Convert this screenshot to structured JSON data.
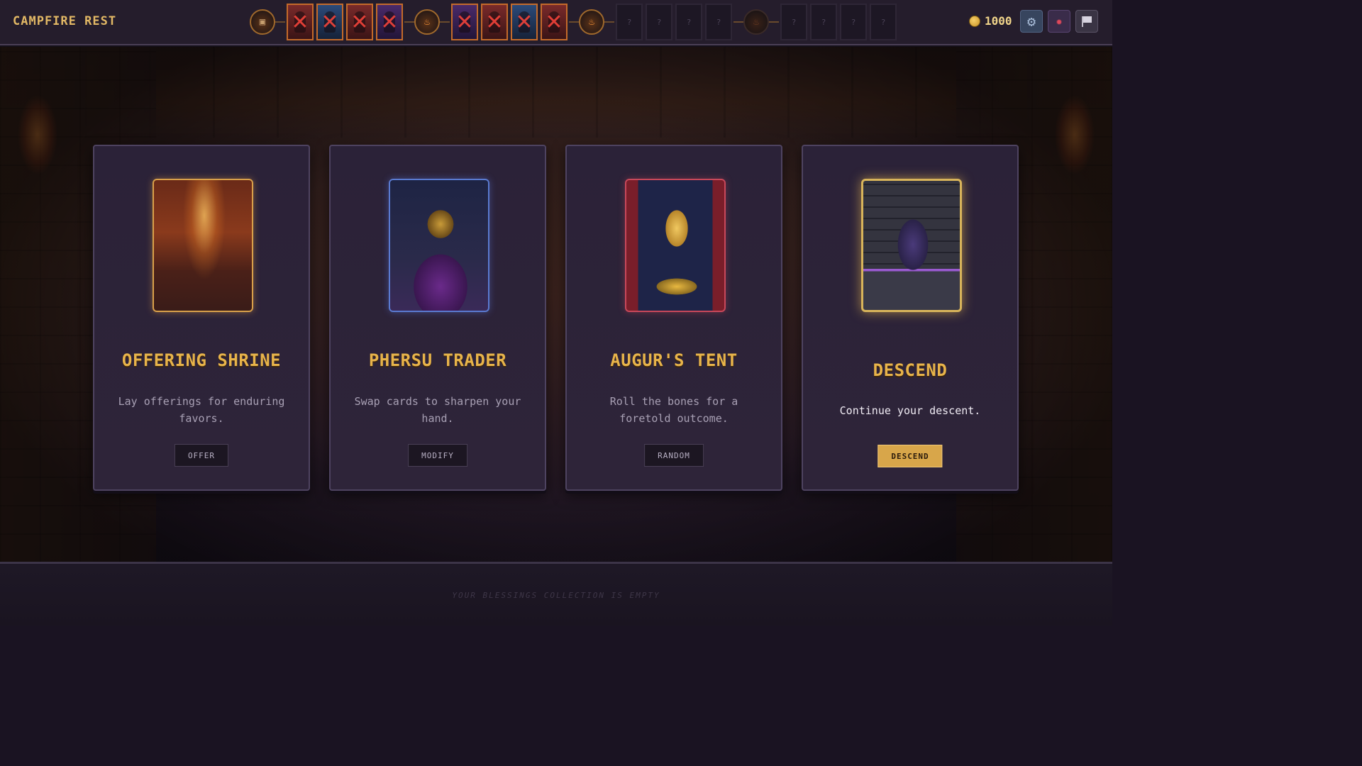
{
  "header": {
    "location_title": "CAMPFIRE REST",
    "gold": "1000"
  },
  "path": {
    "segments": [
      {
        "type": "node",
        "state": "start",
        "icon": "door-icon"
      },
      {
        "type": "encounter",
        "state": "defeated",
        "theme": "red"
      },
      {
        "type": "encounter",
        "state": "defeated",
        "theme": "blue"
      },
      {
        "type": "encounter",
        "state": "defeated",
        "theme": "red"
      },
      {
        "type": "encounter",
        "state": "defeated",
        "theme": "purple"
      },
      {
        "type": "node",
        "state": "campfire",
        "icon": "campfire-icon"
      },
      {
        "type": "encounter",
        "state": "defeated",
        "theme": "purple"
      },
      {
        "type": "encounter",
        "state": "defeated",
        "theme": "red"
      },
      {
        "type": "encounter",
        "state": "defeated",
        "theme": "blue"
      },
      {
        "type": "encounter",
        "state": "defeated",
        "theme": "red"
      },
      {
        "type": "node",
        "state": "current-campfire",
        "icon": "campfire-icon"
      },
      {
        "type": "encounter",
        "state": "unknown",
        "label": "?"
      },
      {
        "type": "encounter",
        "state": "unknown",
        "label": "?"
      },
      {
        "type": "encounter",
        "state": "unknown",
        "label": "?"
      },
      {
        "type": "encounter",
        "state": "unknown",
        "label": "?"
      },
      {
        "type": "node",
        "state": "locked-campfire",
        "icon": "campfire-icon"
      },
      {
        "type": "encounter",
        "state": "unknown",
        "label": "?"
      },
      {
        "type": "encounter",
        "state": "unknown",
        "label": "?"
      },
      {
        "type": "encounter",
        "state": "unknown",
        "label": "?"
      },
      {
        "type": "encounter",
        "state": "unknown",
        "label": "?"
      }
    ]
  },
  "icons": {
    "gold": "coin-icon",
    "settings": "gear-icon",
    "bug": "bug-icon",
    "flag": "flag-icon"
  },
  "cards": [
    {
      "id": "shrine",
      "title": "OFFERING SHRINE",
      "description": "Lay offerings for enduring favors.",
      "button": "OFFER",
      "art": "altar-chalice-art",
      "accent": "#d9a04a"
    },
    {
      "id": "trader",
      "title": "PHERSU TRADER",
      "description": "Swap cards to sharpen your hand.",
      "button": "MODIFY",
      "art": "masked-trader-art",
      "accent": "#5a7ad0"
    },
    {
      "id": "augur",
      "title": "AUGUR'S TENT",
      "description": "Roll the bones for a foretold outcome.",
      "button": "RANDOM",
      "art": "fortune-tent-art",
      "accent": "#c8485a"
    },
    {
      "id": "descend",
      "title": "DESCEND",
      "description": "Continue your descent.",
      "button": "DESCEND",
      "art": "stone-archway-art",
      "accent": "#d8b45a"
    }
  ],
  "footer": {
    "blessings_empty": "YOUR BLESSINGS COLLECTION IS EMPTY"
  }
}
